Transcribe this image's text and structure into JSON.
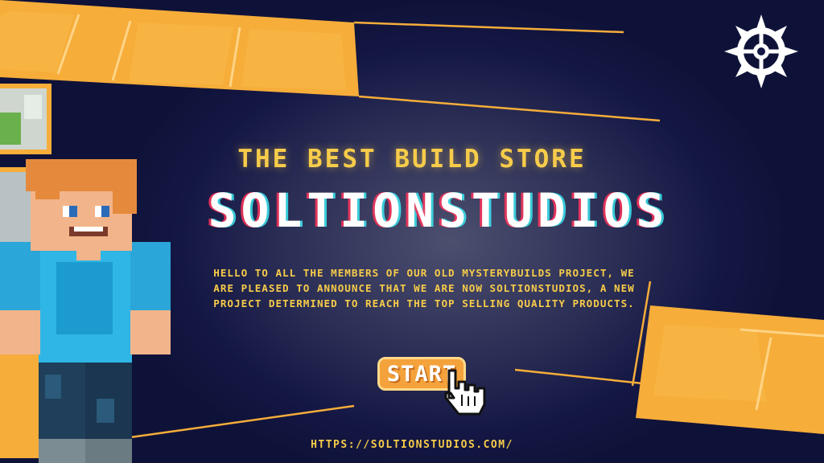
{
  "hero": {
    "tagline": "THE BEST BUILD STORE",
    "title": "SOLTIONSTUDIOS",
    "announcement": "HELLO TO ALL THE MEMBERS OF OUR OLD MYSTERYBUILDS PROJECT, WE ARE PLEASED TO ANNOUNCE THAT WE ARE NOW SOLTIONSTUDIOS, A NEW PROJECT DETERMINED TO REACH THE TOP SELLING QUALITY PRODUCTS.",
    "start_label": "START",
    "url": "HTTPS://SOLTIONSTUDIOS.COM/"
  },
  "icons": {
    "logo": "gear-wheel-icon",
    "cursor": "pointing-hand-cursor-icon",
    "character": "minecraft-character-illustration"
  },
  "colors": {
    "background": "#141744",
    "accent_orange": "#f6ad3a",
    "text_yellow": "#f7cc4a",
    "button": "#f4a23c"
  }
}
